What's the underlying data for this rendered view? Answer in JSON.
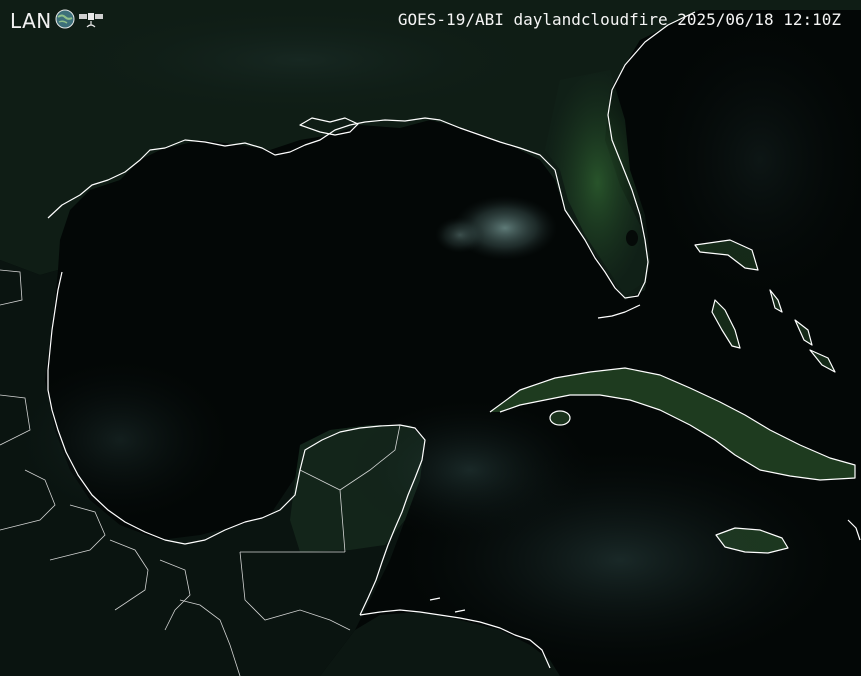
{
  "header": {
    "logo_text": "LAN",
    "title": "GOES-19/ABI daylandcloudfire 2025/06/18 12:10Z"
  },
  "icons": {
    "logo_globe": "globe-icon",
    "logo_satellite": "satellite-icon"
  },
  "colors": {
    "ocean": "#030706",
    "land_dark": "#0e1a12",
    "land_green": "#1f3d22",
    "cloud": "#5c7a78",
    "coastline": "#ffffff"
  }
}
